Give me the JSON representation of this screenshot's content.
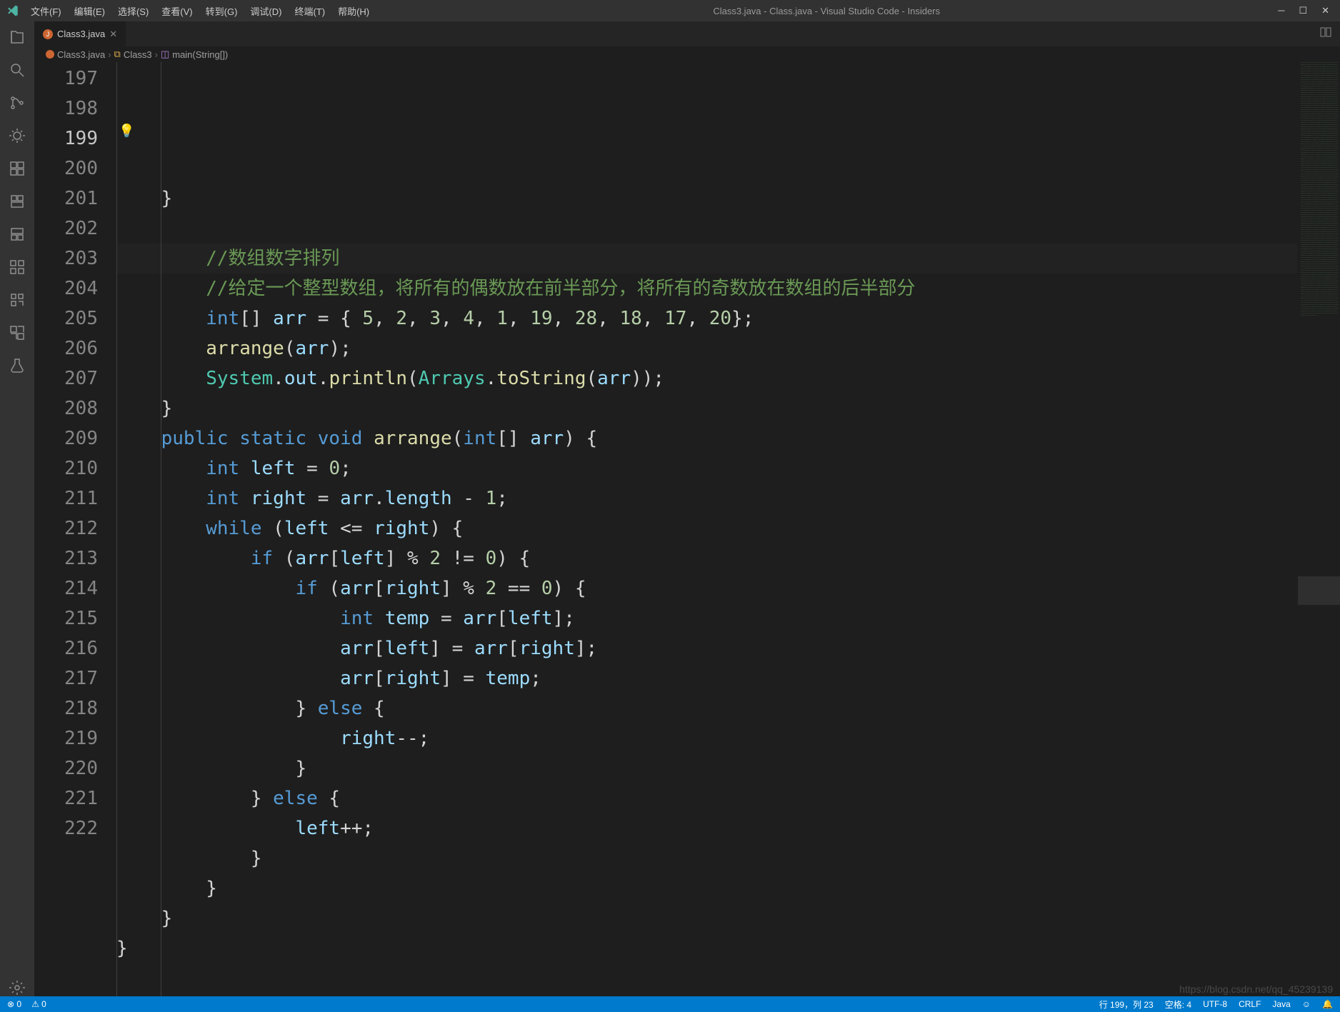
{
  "titlebar": {
    "menu": [
      "文件(F)",
      "编辑(E)",
      "选择(S)",
      "查看(V)",
      "转到(G)",
      "调试(D)",
      "终端(T)",
      "帮助(H)"
    ],
    "title": "Class3.java - Class.java - Visual Studio Code - Insiders"
  },
  "tab": {
    "name": "Class3.java"
  },
  "breadcrumbs": {
    "file": "Class3.java",
    "class": "Class3",
    "method": "main(String[])"
  },
  "gutter": {
    "start": 197,
    "end": 222,
    "active": 199
  },
  "code": {
    "lines": [
      {
        "n": 197,
        "html": "    }"
      },
      {
        "n": 198,
        "html": ""
      },
      {
        "n": 199,
        "html": "        <span class='cmt'>//数组数字排列</span>"
      },
      {
        "n": 200,
        "html": "        <span class='cmt'>//给定一个整型数组，将所有的偶数放在前半部分，将所有的奇数放在数组的后半部分</span>"
      },
      {
        "n": 201,
        "html": "        <span class='type'>int</span>[] <span class='var'>arr</span> = { <span class='num'>5</span>, <span class='num'>2</span>, <span class='num'>3</span>, <span class='num'>4</span>, <span class='num'>1</span>, <span class='num'>19</span>, <span class='num'>28</span>, <span class='num'>18</span>, <span class='num'>17</span>, <span class='num'>20</span>};"
      },
      {
        "n": 202,
        "html": "        <span class='fn'>arrange</span>(<span class='var'>arr</span>);"
      },
      {
        "n": 203,
        "html": "        <span class='cls'>System</span>.<span class='var'>out</span>.<span class='fn'>println</span>(<span class='cls'>Arrays</span>.<span class='fn'>toString</span>(<span class='var'>arr</span>));"
      },
      {
        "n": 204,
        "html": "    }"
      },
      {
        "n": 205,
        "html": "    <span class='kw'>public</span> <span class='kw'>static</span> <span class='type'>void</span> <span class='fn'>arrange</span>(<span class='type'>int</span>[] <span class='var'>arr</span>) {"
      },
      {
        "n": 206,
        "html": "        <span class='type'>int</span> <span class='var'>left</span> = <span class='num'>0</span>;"
      },
      {
        "n": 207,
        "html": "        <span class='type'>int</span> <span class='var'>right</span> = <span class='var'>arr</span>.<span class='var'>length</span> - <span class='num'>1</span>;"
      },
      {
        "n": 208,
        "html": "        <span class='kw'>while</span> (<span class='var'>left</span> &lt;= <span class='var'>right</span>) {"
      },
      {
        "n": 209,
        "html": "            <span class='kw'>if</span> (<span class='var'>arr</span>[<span class='var'>left</span>] % <span class='num'>2</span> != <span class='num'>0</span>) {"
      },
      {
        "n": 210,
        "html": "                <span class='kw'>if</span> (<span class='var'>arr</span>[<span class='var'>right</span>] % <span class='num'>2</span> == <span class='num'>0</span>) {"
      },
      {
        "n": 211,
        "html": "                    <span class='type'>int</span> <span class='var'>temp</span> = <span class='var'>arr</span>[<span class='var'>left</span>];"
      },
      {
        "n": 212,
        "html": "                    <span class='var'>arr</span>[<span class='var'>left</span>] = <span class='var'>arr</span>[<span class='var'>right</span>];"
      },
      {
        "n": 213,
        "html": "                    <span class='var'>arr</span>[<span class='var'>right</span>] = <span class='var'>temp</span>;"
      },
      {
        "n": 214,
        "html": "                } <span class='kw'>else</span> {"
      },
      {
        "n": 215,
        "html": "                    <span class='var'>right</span>--;"
      },
      {
        "n": 216,
        "html": "                }"
      },
      {
        "n": 217,
        "html": "            } <span class='kw'>else</span> {"
      },
      {
        "n": 218,
        "html": "                <span class='var'>left</span>++;"
      },
      {
        "n": 219,
        "html": "            }"
      },
      {
        "n": 220,
        "html": "        }"
      },
      {
        "n": 221,
        "html": "    }"
      },
      {
        "n": 222,
        "html": "}"
      }
    ]
  },
  "statusbar": {
    "errors": "0",
    "warnings": "0",
    "position": "行 199，列 23",
    "spaces": "空格: 4",
    "encoding": "UTF-8",
    "eol": "CRLF",
    "language": "Java"
  },
  "watermark": "https://blog.csdn.net/qq_45239139"
}
